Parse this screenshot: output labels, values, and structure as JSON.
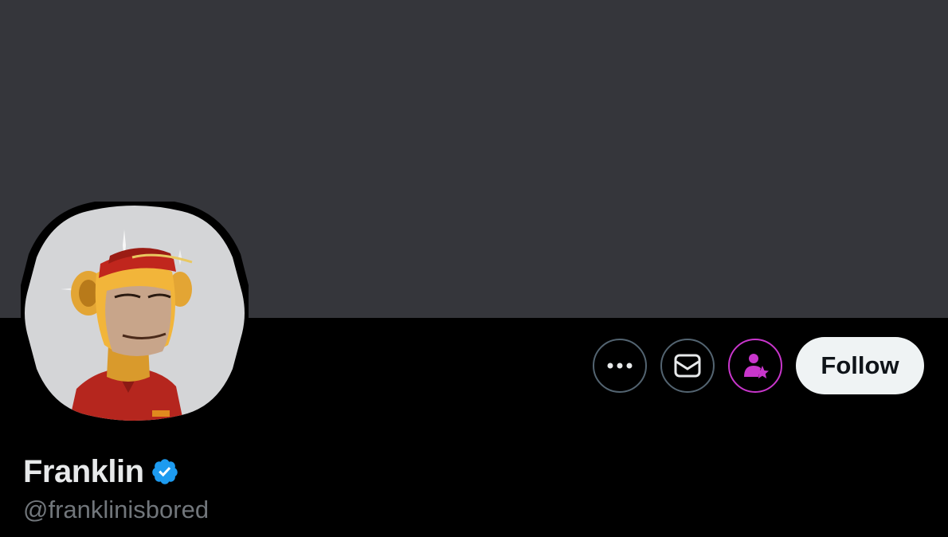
{
  "profile": {
    "display_name": "Franklin",
    "handle": "@franklinisbored",
    "verified": true,
    "verified_icon": "verified-badge-icon",
    "avatar": "bored-ape-avatar"
  },
  "actions": {
    "more_icon": "more-horizontal-icon",
    "message_icon": "envelope-icon",
    "subscribe_icon": "person-star-icon",
    "follow_label": "Follow"
  },
  "colors": {
    "banner": "#35363b",
    "background": "#000000",
    "verified": "#1d9bf0",
    "subscribe_accent": "#c936cc",
    "follow_button_bg": "#eff3f4"
  }
}
